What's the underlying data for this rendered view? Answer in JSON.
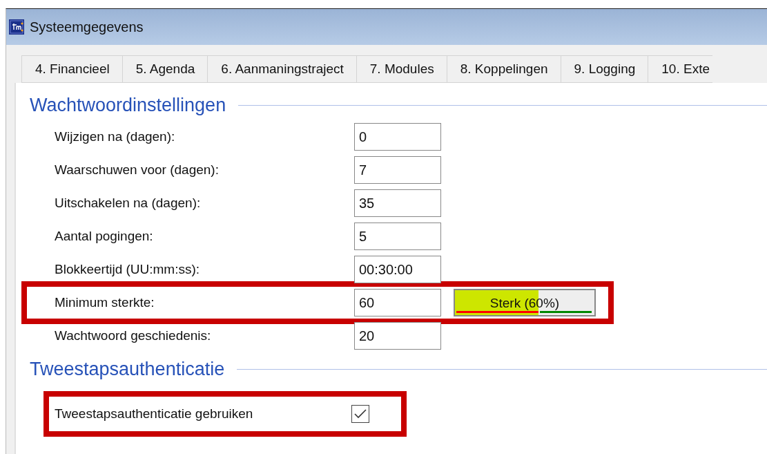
{
  "window": {
    "title": "Systeemgegevens"
  },
  "tabs": [
    {
      "label": "4. Financieel",
      "selected": false
    },
    {
      "label": "5. Agenda",
      "selected": false
    },
    {
      "label": "6. Aanmaningstraject",
      "selected": false
    },
    {
      "label": "7. Modules",
      "selected": false
    },
    {
      "label": "8. Koppelingen",
      "selected": false
    },
    {
      "label": "9. Logging",
      "selected": false
    },
    {
      "label": "10. Exte",
      "selected": false
    }
  ],
  "password_settings": {
    "title": "Wachtwoordinstellingen",
    "rows": [
      {
        "label": "Wijzigen na (dagen):",
        "value": "0",
        "highlighted": false
      },
      {
        "label": "Waarschuwen voor (dagen):",
        "value": "7",
        "highlighted": false
      },
      {
        "label": "Uitschakelen na (dagen):",
        "value": "35",
        "highlighted": false
      },
      {
        "label": "Aantal pogingen:",
        "value": "5",
        "highlighted": false
      },
      {
        "label": "Blokkeertijd (UU:mm:ss):",
        "value": "00:30:00",
        "highlighted": false
      },
      {
        "label": "Minimum sterkte:",
        "value": "60",
        "highlighted": true,
        "meter": {
          "label": "Sterk (60%)"
        }
      },
      {
        "label": "Wachtwoord geschiedenis:",
        "value": "20",
        "highlighted": false
      }
    ]
  },
  "two_factor": {
    "title": "Tweestapsauthenticatie",
    "option": {
      "label": "Tweestapsauthenticatie gebruiken",
      "checked": true,
      "highlighted": true
    }
  }
}
